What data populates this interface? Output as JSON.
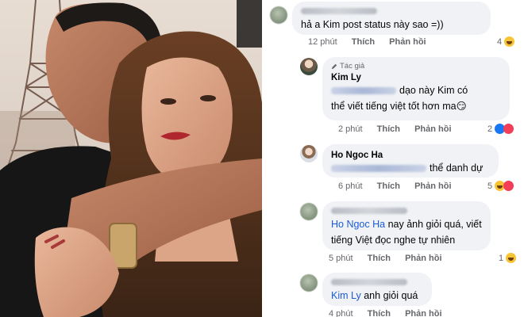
{
  "comments": [
    {
      "name": "",
      "text": "hả a Kim post status này sao =))",
      "time": "12 phút",
      "like": "Thích",
      "reply": "Phản hồi",
      "reactions": "4",
      "reaction_types": [
        "haha-icon"
      ]
    },
    {
      "author_badge": "Tác giả",
      "name": "Kim Ly",
      "text_line1": "dạo này Kim có",
      "text_line2": "thể viết tiếng việt tốt hơn ma",
      "emoji": "😏",
      "time": "2 phút",
      "like": "Thích",
      "reply": "Phản hồi",
      "reactions": "2",
      "reaction_types": [
        "like-icon",
        "love-icon"
      ]
    },
    {
      "name": "Ho Ngoc Ha",
      "text": "thể danh dự",
      "time": "6 phút",
      "like": "Thích",
      "reply": "Phản hồi",
      "reactions": "5",
      "reaction_types": [
        "haha-icon",
        "love-icon"
      ]
    },
    {
      "name": "",
      "mention": "Ho Ngoc Ha",
      "text_line1": "nay ảnh giỏi quá, viết",
      "text_line2": "tiếng Việt đọc nghe tự nhiên",
      "time": "5 phút",
      "like": "Thích",
      "reply": "Phản hồi",
      "reactions": "1",
      "reaction_types": [
        "haha-icon"
      ]
    },
    {
      "name": "",
      "mention": "Kim Ly",
      "text": "anh giỏi quá",
      "time": "4 phút",
      "like": "Thích",
      "reply": "Phản hồi"
    }
  ],
  "colors": {
    "bubble": "#f0f2f5",
    "mention": "#1c5bd6",
    "like_blue": "#1877f2",
    "love_red": "#f33e58",
    "haha_yellow": "#f7c436"
  }
}
